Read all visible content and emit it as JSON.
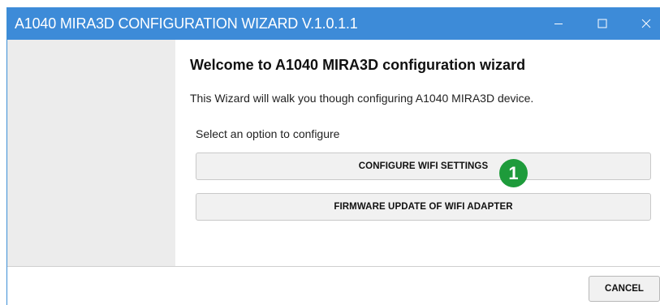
{
  "window": {
    "title": "A1040 MIRA3D CONFIGURATION WIZARD V.1.0.1.1",
    "controls": [
      "minimize-icon",
      "maximize-icon",
      "close-icon"
    ],
    "title_bar_color": "#3d8bd8"
  },
  "main": {
    "heading": "Welcome to A1040 MIRA3D configuration wizard",
    "subtitle": "This Wizard will walk you though configuring A1040 MIRA3D device.",
    "prompt": "Select an option to configure",
    "options": [
      {
        "label": "CONFIGURE WIFI SETTINGS"
      },
      {
        "label": "FIRMWARE UPDATE OF WIFI ADAPTER"
      }
    ],
    "callout": {
      "number": "1",
      "color": "#1e9b3b"
    }
  },
  "footer": {
    "cancel_label": "CANCEL"
  }
}
